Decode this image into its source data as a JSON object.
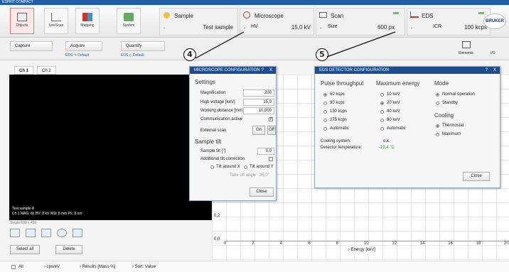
{
  "app": {
    "title": "ESPRIT COMPACT"
  },
  "ribbon": {
    "objects": "Objects",
    "linescan": "LineScan",
    "mapping": "Mapping",
    "system": "System",
    "sample": {
      "title": "Sample",
      "value": "Test sample"
    },
    "microscope": {
      "title": "Microscope",
      "field": "HV",
      "value": "15,0 kV"
    },
    "scan": {
      "title": "Scan",
      "field": "Size",
      "value": "600 px"
    },
    "eds": {
      "title": "EDS",
      "field": "ICR",
      "value": "100 kcps"
    },
    "brand": "BRUKER"
  },
  "toolbar": {
    "capture": "Capture",
    "acquire": "Acquire",
    "quantify": "Quantify",
    "acq_sub": "EDS ↷ Default",
    "quant_sub": "EDS ◇ Default",
    "elements": "Elements",
    "io": "I/O"
  },
  "tabs": [
    "Ch 1",
    "Ch 2"
  ],
  "image": {
    "line1": "Test sample 8",
    "line2": "Ch 1  MAG: 8x   HV: 8 kV   WD: 8 mm   Px: 8 nm",
    "line3": "Single   600 x 450"
  },
  "left_controls": {
    "select_all": "Select all",
    "delete": "Delete"
  },
  "chart_data": {
    "type": "line",
    "xlabel": "Energy [keV]",
    "x_ticks": [
      "0",
      "2",
      "4",
      "6",
      "8",
      "10",
      "12",
      "14",
      "16",
      "18",
      "20"
    ],
    "y_ticks": [
      "0,2",
      "0,0"
    ],
    "xlim": [
      0,
      20
    ],
    "series": []
  },
  "bottom": {
    "all": "All",
    "unit": "cps/eV",
    "results": "Results [Mass-%]",
    "sort": "Sort: Value"
  },
  "mic_dialog": {
    "title": "MICROSCOPE CONFIGURATION",
    "q": "?",
    "x": "X",
    "settings": "Settings",
    "mag_label": "Magnification",
    "mag": "200",
    "hv_label": "High voltage [keV]",
    "hv": "15,0",
    "wd_label": "Working distance [mm]",
    "wd": "10,000",
    "comm_label": "Communication active",
    "comm_check": "✓",
    "ext_label": "External scan",
    "on": "On",
    "off": "Off",
    "tilt_header": "Sample tilt",
    "tilt_label": "Sample tilt [°]",
    "tilt": "0,0",
    "add_tilt": "Additional tilt correction",
    "tilt_x": "Tilt around X",
    "tilt_y": "Tilt around Y",
    "takeoff_label": "Take off angle",
    "takeoff": "35,0°",
    "close": "Close"
  },
  "eds_dialog": {
    "title": "EDS DETECTOR CONFIGURATION",
    "q": "?",
    "x": "X",
    "pulse_header": "Pulse throughput",
    "energy_header": "Maximum energy",
    "mode_header": "Mode",
    "pulse": [
      "60 kcps",
      "90 kcps",
      "130 kcps",
      "275 kcps",
      "Automatic"
    ],
    "energy": [
      "10 keV",
      "20 keV",
      "40 keV",
      "80 keV",
      "Automatic"
    ],
    "mode": [
      "Normal operation",
      "Standby"
    ],
    "cooling_header": "Cooling",
    "cooling": [
      "Thermostat",
      "Maximum"
    ],
    "cooling_sys_label": "Cooling system:",
    "cooling_sys": "o.k.",
    "det_temp_label": "Detector temperature:",
    "det_temp": "-19,4 °C",
    "close": "Close"
  },
  "callouts": {
    "c4": "4",
    "c5": "5"
  }
}
